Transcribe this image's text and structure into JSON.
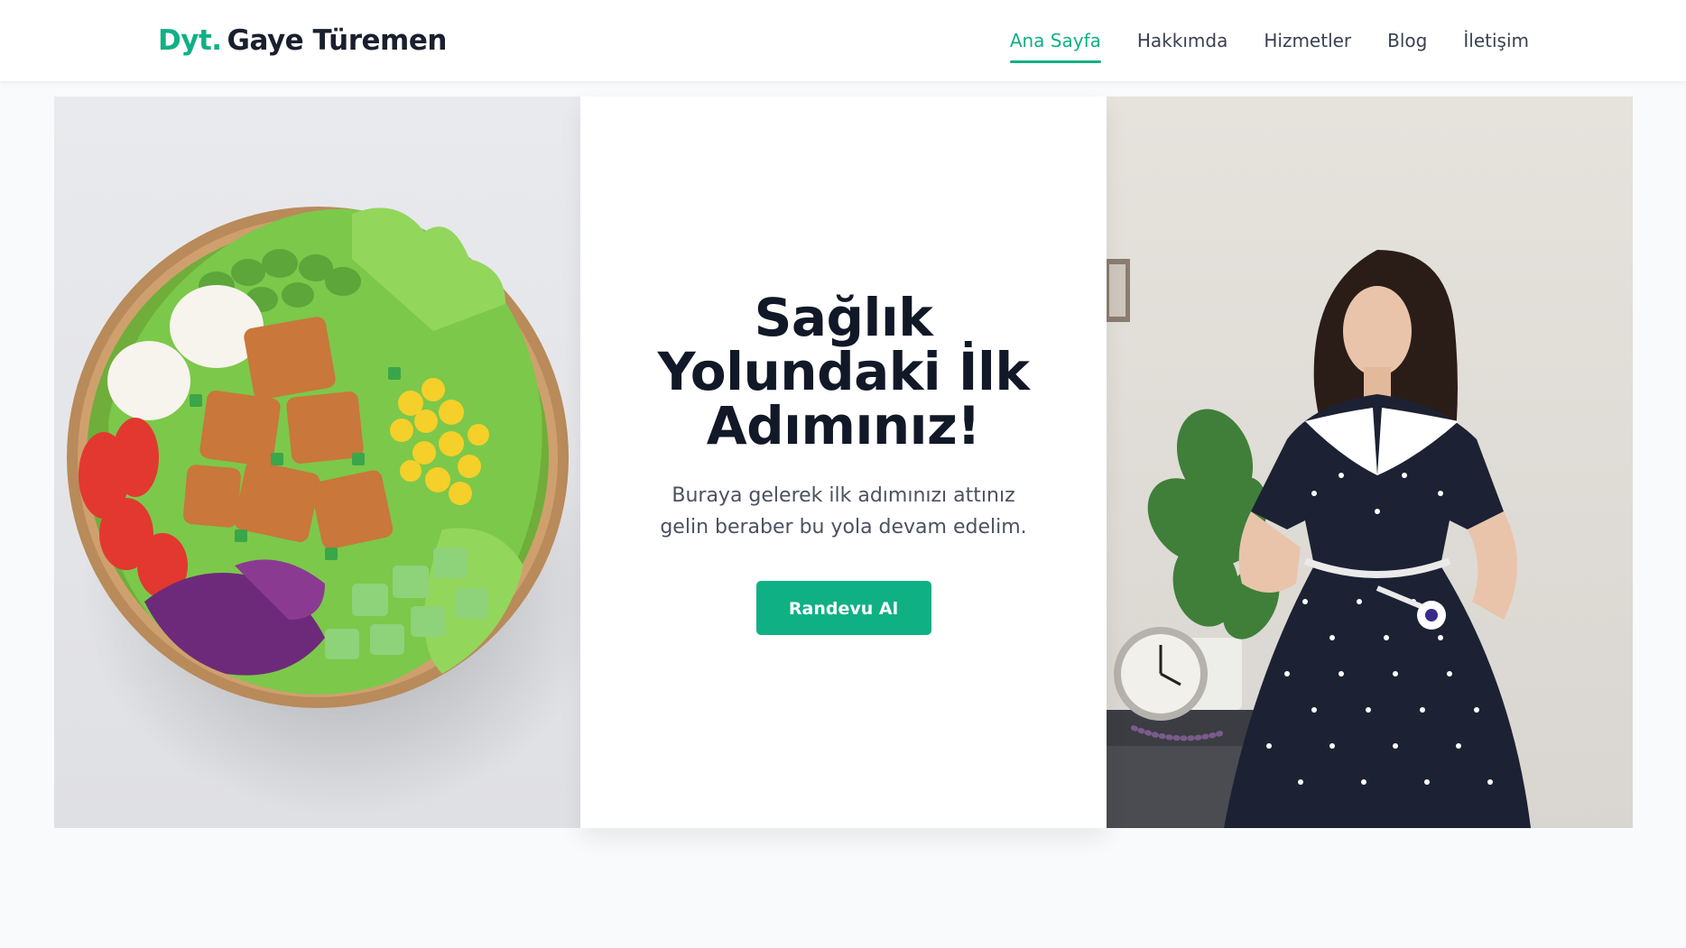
{
  "brand": {
    "accent": "Dyt.",
    "name": "Gaye Türemen"
  },
  "nav": {
    "items": [
      {
        "label": "Ana Sayfa",
        "active": true
      },
      {
        "label": "Hakkımda",
        "active": false
      },
      {
        "label": "Hizmetler",
        "active": false
      },
      {
        "label": "Blog",
        "active": false
      },
      {
        "label": "İletişim",
        "active": false
      }
    ]
  },
  "hero": {
    "title": "Sağlık Yolundaki İlk Adımınız!",
    "text": "Buraya gelerek ilk adımınızı attınız gelin beraber bu yola devam edelim.",
    "cta_label": "Randevu Al"
  },
  "images": {
    "left": "salad-bowl-photo",
    "right": "dietitian-photo"
  },
  "colors": {
    "accent": "#10b085",
    "text_dark": "#111827",
    "nav_text": "#3a4150",
    "page_bg": "#f8fafb"
  }
}
